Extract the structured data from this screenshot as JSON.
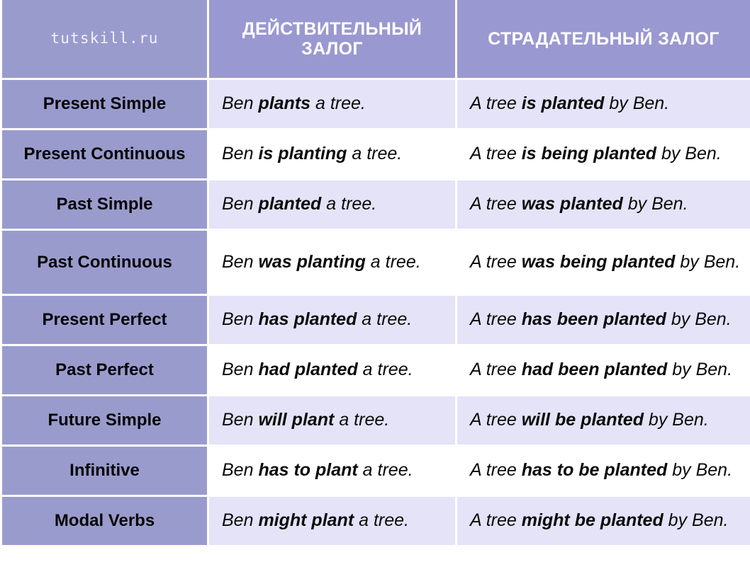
{
  "watermark": "tutskill.ru",
  "header": {
    "tense_col_label": "tutskill.ru",
    "active_label": "ДЕЙСТВИТЕЛЬНЫЙ ЗАЛОГ",
    "active_label_line1": "ДЕЙСТВИТЕЛЬНЫЙ",
    "active_label_line2": "ЗАЛОГ",
    "passive_label": "СТРАДАТЕЛЬНЫЙ ЗАЛОГ"
  },
  "colors": {
    "header_purple": "#9a98d0",
    "tense_purple": "#9a9bcd",
    "row_shade": "#e4e3f8",
    "row_plain": "#ffffff",
    "grid_line": "#ffffff",
    "text": "#0a0a0a",
    "header_text": "#ffffff"
  },
  "rows": [
    {
      "tense": "Present Simple",
      "active": {
        "pre": "Ben ",
        "verb": "plants",
        "post": " a tree."
      },
      "passive": {
        "pre": "A tree ",
        "verb": "is planted",
        "post": " by Ben."
      },
      "active_text": "Ben plants a tree.",
      "passive_text": "A tree is planted by Ben.",
      "shade": true,
      "tall": false
    },
    {
      "tense": "Present Continuous",
      "active": {
        "pre": "Ben ",
        "verb": "is planting",
        "post": " a tree."
      },
      "passive": {
        "pre": "A tree ",
        "verb": "is being planted",
        "post": " by Ben."
      },
      "active_text": "Ben is planting a tree.",
      "passive_text": "A tree is being planted by Ben.",
      "shade": false,
      "tall": false
    },
    {
      "tense": "Past Simple",
      "active": {
        "pre": "Ben ",
        "verb": "planted",
        "post": " a tree."
      },
      "passive": {
        "pre": "A tree ",
        "verb": "was planted",
        "post": " by Ben."
      },
      "active_text": "Ben planted a tree.",
      "passive_text": "A tree was planted by Ben.",
      "shade": true,
      "tall": false
    },
    {
      "tense": "Past Continuous",
      "active": {
        "pre": "Ben ",
        "verb": "was planting",
        "post": " a tree."
      },
      "passive": {
        "pre": "A tree ",
        "verb": "was being planted",
        "post": " by Ben."
      },
      "active_text": "Ben was planting a tree.",
      "passive_text": "A tree was being planted by Ben.",
      "shade": false,
      "tall": true
    },
    {
      "tense": "Present Perfect",
      "active": {
        "pre": "Ben ",
        "verb": "has planted",
        "post": " a tree."
      },
      "passive": {
        "pre": "A tree ",
        "verb": "has been planted",
        "post": " by Ben."
      },
      "active_text": "Ben has planted a tree.",
      "passive_text": "A tree has been planted by Ben.",
      "shade": true,
      "tall": false
    },
    {
      "tense": "Past Perfect",
      "active": {
        "pre": "Ben ",
        "verb": "had planted",
        "post": " a tree."
      },
      "passive": {
        "pre": "A tree ",
        "verb": "had been planted",
        "post": " by Ben."
      },
      "active_text": "Ben had planted a tree.",
      "passive_text": "A tree had been planted by Ben.",
      "shade": false,
      "tall": false
    },
    {
      "tense": "Future Simple",
      "active": {
        "pre": "Ben ",
        "verb": "will plant",
        "post": " a tree."
      },
      "passive": {
        "pre": "A tree ",
        "verb": "will be planted",
        "post": " by Ben."
      },
      "active_text": "Ben will plant a tree.",
      "passive_text": "A tree will be planted by Ben.",
      "shade": true,
      "tall": false
    },
    {
      "tense": "Infinitive",
      "active": {
        "pre": "Ben ",
        "verb": "has to plant",
        "post": " a tree."
      },
      "passive": {
        "pre": "A tree ",
        "verb": "has to be planted",
        "post": " by Ben."
      },
      "active_text": "Ben has to plant a tree.",
      "passive_text": "A tree has to be planted by Ben.",
      "shade": false,
      "tall": false
    },
    {
      "tense": "Modal Verbs",
      "active": {
        "pre": "Ben ",
        "verb": "might plant",
        "post": " a tree."
      },
      "passive": {
        "pre": "A tree ",
        "verb": "might be planted",
        "post": " by Ben."
      },
      "active_text": "Ben might plant a tree.",
      "passive_text": "A tree might be planted by Ben.",
      "shade": true,
      "tall": false
    }
  ]
}
